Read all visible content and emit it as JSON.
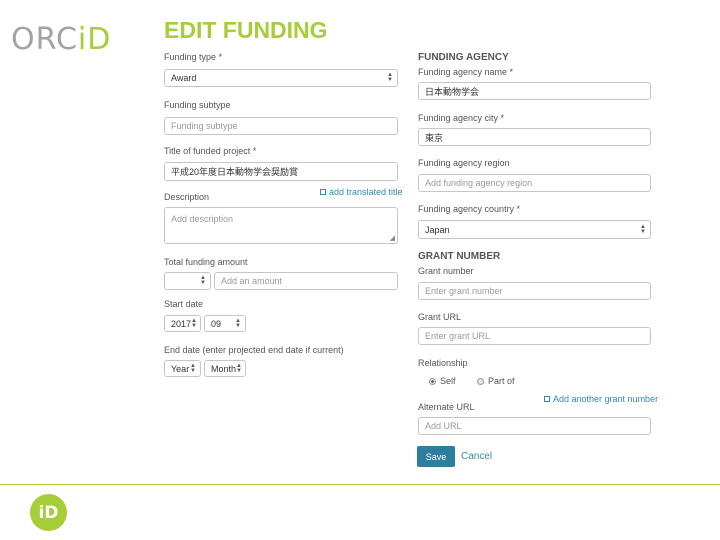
{
  "logo": {
    "text_a": "ORC",
    "text_b": "iD"
  },
  "page_title": "EDIT FUNDING",
  "left": {
    "funding_type": {
      "label": "Funding type *",
      "value": "Award"
    },
    "funding_subtype": {
      "label": "Funding subtype",
      "placeholder": "Funding subtype"
    },
    "title_project": {
      "label": "Title of funded project *",
      "value": "平成20年度日本動物学会奨励賞"
    },
    "add_translated_title": "add translated title",
    "description": {
      "label": "Description",
      "placeholder": "Add description"
    },
    "total_amount": {
      "label": "Total funding amount",
      "currency_value": "",
      "amount_placeholder": "Add an amount"
    },
    "start_date": {
      "label": "Start date",
      "year": "2017",
      "month": "09"
    },
    "end_date": {
      "label": "End date (enter projected end date if current)",
      "year": "Year",
      "month": "Month"
    }
  },
  "right": {
    "agency_header": "FUNDING AGENCY",
    "agency_name": {
      "label": "Funding agency name *",
      "value": "日本動物学会"
    },
    "agency_city": {
      "label": "Funding agency city *",
      "value": "東京"
    },
    "agency_region": {
      "label": "Funding agency region",
      "placeholder": "Add funding agency region"
    },
    "agency_country": {
      "label": "Funding agency country *",
      "value": "Japan"
    },
    "grant_header": "GRANT NUMBER",
    "grant_number": {
      "label": "Grant number",
      "placeholder": "Enter grant number"
    },
    "grant_url": {
      "label": "Grant URL",
      "placeholder": "Enter grant URL"
    },
    "relationship": {
      "label": "Relationship",
      "option_self": "Self",
      "option_part_of": "Part of",
      "selected": "Self"
    },
    "add_another_grant": "Add another grant number",
    "alternate_url": {
      "label": "Alternate URL",
      "placeholder": "Add URL"
    },
    "save_label": "Save",
    "cancel_label": "Cancel"
  },
  "footer": {
    "badge_text": "iD"
  },
  "colors": {
    "brand_green": "#a6ce39",
    "link_blue": "#338caf",
    "button_blue": "#2e7f9f"
  }
}
